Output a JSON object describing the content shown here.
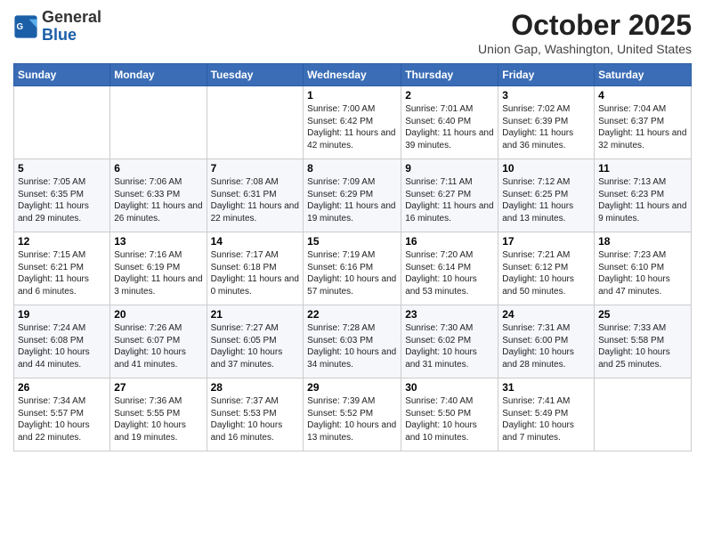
{
  "header": {
    "logo_general": "General",
    "logo_blue": "Blue",
    "month_title": "October 2025",
    "location": "Union Gap, Washington, United States"
  },
  "days_of_week": [
    "Sunday",
    "Monday",
    "Tuesday",
    "Wednesday",
    "Thursday",
    "Friday",
    "Saturday"
  ],
  "weeks": [
    [
      {
        "day": "",
        "info": ""
      },
      {
        "day": "",
        "info": ""
      },
      {
        "day": "",
        "info": ""
      },
      {
        "day": "1",
        "info": "Sunrise: 7:00 AM\nSunset: 6:42 PM\nDaylight: 11 hours and 42 minutes."
      },
      {
        "day": "2",
        "info": "Sunrise: 7:01 AM\nSunset: 6:40 PM\nDaylight: 11 hours and 39 minutes."
      },
      {
        "day": "3",
        "info": "Sunrise: 7:02 AM\nSunset: 6:39 PM\nDaylight: 11 hours and 36 minutes."
      },
      {
        "day": "4",
        "info": "Sunrise: 7:04 AM\nSunset: 6:37 PM\nDaylight: 11 hours and 32 minutes."
      }
    ],
    [
      {
        "day": "5",
        "info": "Sunrise: 7:05 AM\nSunset: 6:35 PM\nDaylight: 11 hours and 29 minutes."
      },
      {
        "day": "6",
        "info": "Sunrise: 7:06 AM\nSunset: 6:33 PM\nDaylight: 11 hours and 26 minutes."
      },
      {
        "day": "7",
        "info": "Sunrise: 7:08 AM\nSunset: 6:31 PM\nDaylight: 11 hours and 22 minutes."
      },
      {
        "day": "8",
        "info": "Sunrise: 7:09 AM\nSunset: 6:29 PM\nDaylight: 11 hours and 19 minutes."
      },
      {
        "day": "9",
        "info": "Sunrise: 7:11 AM\nSunset: 6:27 PM\nDaylight: 11 hours and 16 minutes."
      },
      {
        "day": "10",
        "info": "Sunrise: 7:12 AM\nSunset: 6:25 PM\nDaylight: 11 hours and 13 minutes."
      },
      {
        "day": "11",
        "info": "Sunrise: 7:13 AM\nSunset: 6:23 PM\nDaylight: 11 hours and 9 minutes."
      }
    ],
    [
      {
        "day": "12",
        "info": "Sunrise: 7:15 AM\nSunset: 6:21 PM\nDaylight: 11 hours and 6 minutes."
      },
      {
        "day": "13",
        "info": "Sunrise: 7:16 AM\nSunset: 6:19 PM\nDaylight: 11 hours and 3 minutes."
      },
      {
        "day": "14",
        "info": "Sunrise: 7:17 AM\nSunset: 6:18 PM\nDaylight: 11 hours and 0 minutes."
      },
      {
        "day": "15",
        "info": "Sunrise: 7:19 AM\nSunset: 6:16 PM\nDaylight: 10 hours and 57 minutes."
      },
      {
        "day": "16",
        "info": "Sunrise: 7:20 AM\nSunset: 6:14 PM\nDaylight: 10 hours and 53 minutes."
      },
      {
        "day": "17",
        "info": "Sunrise: 7:21 AM\nSunset: 6:12 PM\nDaylight: 10 hours and 50 minutes."
      },
      {
        "day": "18",
        "info": "Sunrise: 7:23 AM\nSunset: 6:10 PM\nDaylight: 10 hours and 47 minutes."
      }
    ],
    [
      {
        "day": "19",
        "info": "Sunrise: 7:24 AM\nSunset: 6:08 PM\nDaylight: 10 hours and 44 minutes."
      },
      {
        "day": "20",
        "info": "Sunrise: 7:26 AM\nSunset: 6:07 PM\nDaylight: 10 hours and 41 minutes."
      },
      {
        "day": "21",
        "info": "Sunrise: 7:27 AM\nSunset: 6:05 PM\nDaylight: 10 hours and 37 minutes."
      },
      {
        "day": "22",
        "info": "Sunrise: 7:28 AM\nSunset: 6:03 PM\nDaylight: 10 hours and 34 minutes."
      },
      {
        "day": "23",
        "info": "Sunrise: 7:30 AM\nSunset: 6:02 PM\nDaylight: 10 hours and 31 minutes."
      },
      {
        "day": "24",
        "info": "Sunrise: 7:31 AM\nSunset: 6:00 PM\nDaylight: 10 hours and 28 minutes."
      },
      {
        "day": "25",
        "info": "Sunrise: 7:33 AM\nSunset: 5:58 PM\nDaylight: 10 hours and 25 minutes."
      }
    ],
    [
      {
        "day": "26",
        "info": "Sunrise: 7:34 AM\nSunset: 5:57 PM\nDaylight: 10 hours and 22 minutes."
      },
      {
        "day": "27",
        "info": "Sunrise: 7:36 AM\nSunset: 5:55 PM\nDaylight: 10 hours and 19 minutes."
      },
      {
        "day": "28",
        "info": "Sunrise: 7:37 AM\nSunset: 5:53 PM\nDaylight: 10 hours and 16 minutes."
      },
      {
        "day": "29",
        "info": "Sunrise: 7:39 AM\nSunset: 5:52 PM\nDaylight: 10 hours and 13 minutes."
      },
      {
        "day": "30",
        "info": "Sunrise: 7:40 AM\nSunset: 5:50 PM\nDaylight: 10 hours and 10 minutes."
      },
      {
        "day": "31",
        "info": "Sunrise: 7:41 AM\nSunset: 5:49 PM\nDaylight: 10 hours and 7 minutes."
      },
      {
        "day": "",
        "info": ""
      }
    ]
  ]
}
